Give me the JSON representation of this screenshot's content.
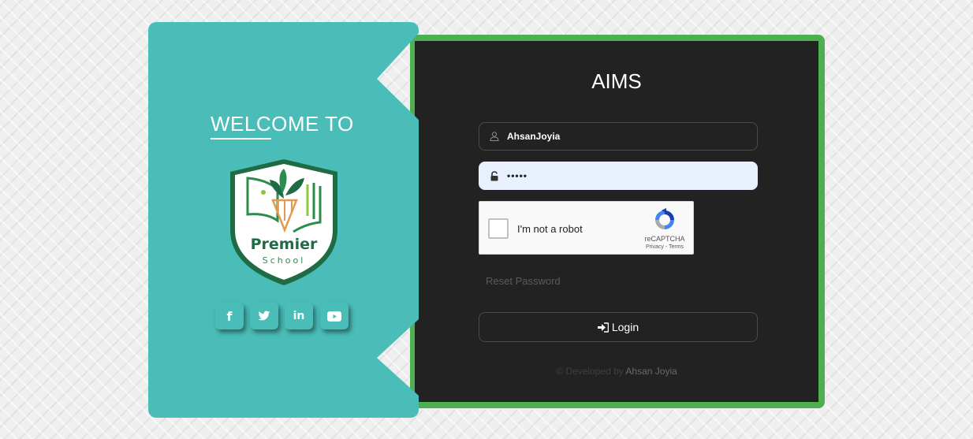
{
  "welcome": {
    "heading": "WELCOME TO",
    "logo": {
      "name": "Premier",
      "subtitle": "School",
      "colors": {
        "shield_border": "#1f6b44",
        "green": "#2e8b4e",
        "pencil": "#e39a4c"
      }
    },
    "social": [
      {
        "icon": "facebook-icon",
        "glyph": "f"
      },
      {
        "icon": "twitter-icon"
      },
      {
        "icon": "linkedin-icon",
        "glyph": "in"
      },
      {
        "icon": "youtube-icon"
      }
    ]
  },
  "login": {
    "title": "AIMS",
    "username": {
      "value": "AhsanJoyia",
      "icon": "user-icon"
    },
    "password": {
      "value": "•••••",
      "icon": "lock-icon"
    },
    "captcha": {
      "label": "I'm not a robot",
      "brand": "reCAPTCHA",
      "links": "Privacy - Terms"
    },
    "reset_link": "Reset Password",
    "login_button": {
      "label": "Login",
      "icon": "sign-in-icon"
    },
    "footer": {
      "prefix": "© Developed by",
      "author": "Ahsan Joyia"
    }
  },
  "colors": {
    "teal": "#4bbdb8",
    "frame_green": "#4caf50",
    "card_dark": "#222222",
    "autofill_blue": "#e8f0fe"
  }
}
